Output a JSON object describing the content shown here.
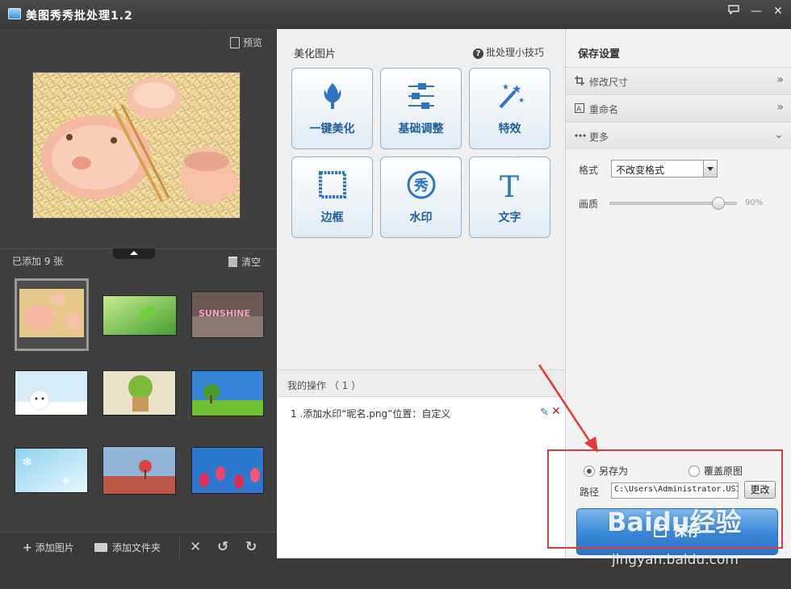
{
  "window": {
    "title": "美图秀秀批处理1.2",
    "buttons": {
      "feedback_icon": "chat-icon",
      "minimize": "—",
      "close": "✕"
    }
  },
  "left_panel": {
    "preview_label": "预览",
    "added_count": "已添加 9 张",
    "clear_label": "清空",
    "thumbnails": [
      {
        "name": "pig-bowls",
        "selected": true
      },
      {
        "name": "green-leaf"
      },
      {
        "name": "sunshine-letters"
      },
      {
        "name": "snow-bear"
      },
      {
        "name": "potted-plant"
      },
      {
        "name": "green-tree"
      },
      {
        "name": "snowflakes"
      },
      {
        "name": "heart-tree"
      },
      {
        "name": "red-flowers"
      }
    ],
    "footer": {
      "add_image": "添加图片",
      "add_folder": "添加文件夹"
    }
  },
  "middle_panel": {
    "section_title": "美化图片",
    "tips_label": "批处理小技巧",
    "tools": [
      {
        "label": "一键美化",
        "icon": "tulip-icon"
      },
      {
        "label": "基础调整",
        "icon": "sliders-icon"
      },
      {
        "label": "特效",
        "icon": "magic-wand-icon"
      },
      {
        "label": "边框",
        "icon": "frame-icon"
      },
      {
        "label": "水印",
        "icon": "xiu-badge-icon"
      },
      {
        "label": "文字",
        "icon": "text-t-icon"
      }
    ],
    "operations_title": "我的操作 （ 1 ）",
    "operations": [
      {
        "text": "1 .添加水印“昵名.png”位置：自定义"
      }
    ]
  },
  "right_panel": {
    "title": "保存设置",
    "accordion": [
      {
        "label": "修改尺寸",
        "icon": "crop-icon",
        "chevron": "»"
      },
      {
        "label": "重命名",
        "icon": "rename-icon",
        "chevron": "»"
      },
      {
        "label": "更多",
        "icon": "more-dots-icon",
        "chevron": "⌄"
      }
    ],
    "format_label": "格式",
    "format_value": "不改变格式",
    "quality_label": "画质",
    "quality_value": "90%",
    "quality_fraction": 0.9,
    "save_as_label": "另存为",
    "overwrite_label": "覆盖原图",
    "path_label": "路径",
    "path_value": "C:\\Users\\Administrator.USI",
    "change_button": "更改",
    "save_button": "保存"
  },
  "watermark": {
    "brand": "Baidu经验",
    "sub": "jingyan.baidu.com"
  },
  "colors": {
    "accent_blue": "#3a86d8",
    "tool_label_blue": "#1e5f9c",
    "annotation_red": "#e03a3a",
    "dark_bg": "#3f3f3f"
  }
}
